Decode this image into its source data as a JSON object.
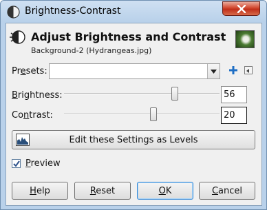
{
  "window": {
    "title": "Brightness-Contrast",
    "close_icon": "close-icon"
  },
  "header": {
    "title": "Adjust Brightness and Contrast",
    "subtitle": "Background-2 (Hydrangeas.jpg)"
  },
  "presets": {
    "label_pre": "Pr",
    "label_mnemonic": "e",
    "label_post": "sets:",
    "value": "",
    "add_icon": "plus-icon",
    "menu_icon": "menu-arrow-icon"
  },
  "brightness": {
    "label_mnemonic": "B",
    "label_post": "rightness:",
    "value": "56",
    "min": -127,
    "max": 127
  },
  "contrast": {
    "label_pre": "Co",
    "label_mnemonic": "n",
    "label_post": "trast:",
    "value": "20",
    "min": -127,
    "max": 127
  },
  "levels_button": {
    "label": "Edit these Settings as Levels"
  },
  "preview": {
    "label_mnemonic": "P",
    "label_post": "review",
    "checked": true
  },
  "buttons": {
    "help": {
      "mnemonic": "H",
      "post": "elp"
    },
    "reset": {
      "mnemonic": "R",
      "post": "eset"
    },
    "ok": {
      "mnemonic": "O",
      "post": "K"
    },
    "cancel": {
      "mnemonic": "C",
      "post": "ancel"
    }
  },
  "colors": {
    "accent": "#1f6fc5",
    "close": "#c7402a"
  }
}
